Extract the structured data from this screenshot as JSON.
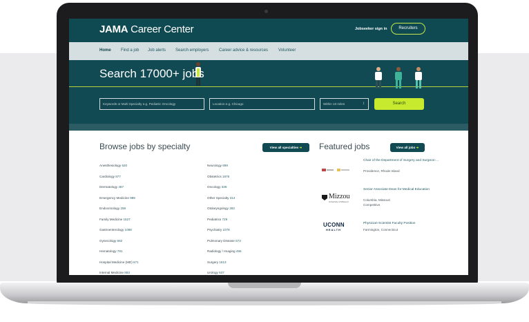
{
  "header": {
    "logo_bold": "JAMA",
    "logo_rest": " Career Center",
    "signin": "Jobseeker sign in",
    "recruiters": "Recruiters"
  },
  "nav": [
    "Home",
    "Find a job",
    "Job alerts",
    "Search employers",
    "Career advice & resources",
    "Volunteer"
  ],
  "hero": {
    "title": "Search 17000+ jobs",
    "keywords_placeholder": "Keywords or Multi Specialty e.g. Pediatric Oncology",
    "location_placeholder": "Location e.g. Chicago",
    "radius": "Within 10 miles",
    "search": "Search"
  },
  "browse": {
    "title": "Browse jobs by specialty",
    "view_all": "View all specialties",
    "left": [
      {
        "name": "Anesthesiology",
        "count": "620"
      },
      {
        "name": "Cardiology",
        "count": "877"
      },
      {
        "name": "Dermatology",
        "count": "467"
      },
      {
        "name": "Emergency Medicine",
        "count": "989"
      },
      {
        "name": "Endocrinology",
        "count": "258"
      },
      {
        "name": "Family Medicine",
        "count": "1627"
      },
      {
        "name": "Gastroenterology",
        "count": "1098"
      },
      {
        "name": "Gynecology",
        "count": "582"
      },
      {
        "name": "Hematology",
        "count": "781"
      },
      {
        "name": "Hospital Medicine (MD)",
        "count": "671"
      },
      {
        "name": "Internal Medicine",
        "count": "883"
      }
    ],
    "right": [
      {
        "name": "Neurology",
        "count": "699"
      },
      {
        "name": "Obstetrics",
        "count": "1876"
      },
      {
        "name": "Oncology",
        "count": "339"
      },
      {
        "name": "Other Specialty",
        "count": "314"
      },
      {
        "name": "Otolaryngology",
        "count": "283"
      },
      {
        "name": "Pediatrics",
        "count": "729"
      },
      {
        "name": "Psychiatry",
        "count": "1078"
      },
      {
        "name": "Pulmonary Disease",
        "count": "573"
      },
      {
        "name": "Radiology / Imaging",
        "count": "466"
      },
      {
        "name": "Surgery",
        "count": "1613"
      },
      {
        "name": "Urology",
        "count": "537"
      }
    ]
  },
  "featured": {
    "title": "Featured jobs",
    "view_all": "View all jobs",
    "jobs": [
      {
        "title": "Chair of the Department of Surgery and Surgeon-...",
        "meta": [
          "Providence, Rhode Island"
        ],
        "logo": "hospital-logo"
      },
      {
        "title": "Senior Associate Dean for Medical Education",
        "meta": [
          "Columbia, Missouri",
          "Competitive"
        ],
        "logo_text": "Mizzou",
        "logo_sub": "University of Missouri"
      },
      {
        "title": "Physician-Scientist Faculty Position",
        "meta": [
          "Farmington, Connecticut"
        ],
        "logo_text": "UCONN",
        "logo_sub": "HEALTH"
      }
    ]
  },
  "colors": {
    "brand": "#124a54",
    "accent": "#c7ea2f"
  }
}
